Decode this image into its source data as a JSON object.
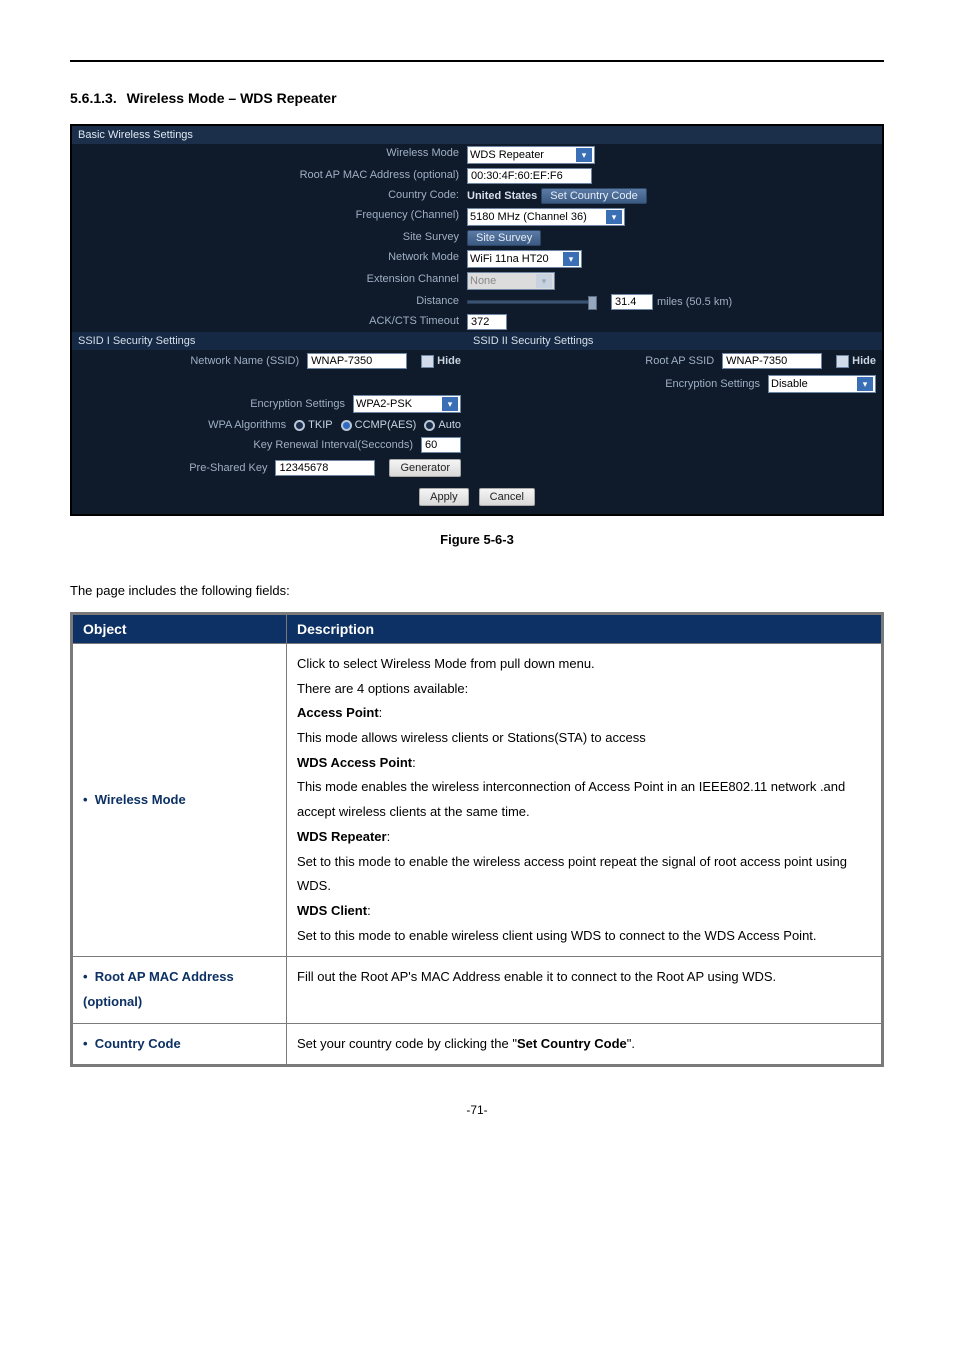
{
  "heading": {
    "num": "5.6.1.3.",
    "title": "Wireless Mode – WDS Repeater"
  },
  "panel": {
    "section_basic": "Basic Wireless Settings",
    "labels": {
      "wireless_mode": "Wireless Mode",
      "root_ap_mac": "Root AP MAC Address (optional)",
      "country_code": "Country Code:",
      "frequency": "Frequency (Channel)",
      "site_survey": "Site Survey",
      "network_mode": "Network Mode",
      "ext_channel": "Extension Channel",
      "distance": "Distance",
      "ack": "ACK/CTS Timeout"
    },
    "values": {
      "wireless_mode": "WDS Repeater",
      "root_ap_mac": "00:30:4F:60:EF:F6",
      "country_code_val": "United States",
      "set_country_code_btn": "Set Country Code",
      "frequency": "5180 MHz (Channel 36)",
      "site_survey_btn": "Site Survey",
      "network_mode": "WiFi 11na HT20",
      "ext_channel": "None",
      "distance_miles": "31.4",
      "distance_unit": "miles (50.5 km)",
      "ack": "372"
    },
    "sec_titles": {
      "ssid1": "SSID I Security Settings",
      "ssid2": "SSID II Security Settings"
    },
    "ssid1": {
      "network_name_lbl": "Network Name (SSID)",
      "network_name_val": "WNAP-7350",
      "hide_lbl": "Hide",
      "encryption_lbl": "Encryption Settings",
      "encryption_val": "WPA2-PSK",
      "wpa_alg_lbl": "WPA Algorithms",
      "tkip": "TKIP",
      "ccmp": "CCMP(AES)",
      "auto": "Auto",
      "key_renewal_lbl": "Key Renewal Interval(Secconds)",
      "key_renewal_val": "60",
      "psk_lbl": "Pre-Shared Key",
      "psk_val": "12345678",
      "gen_btn": "Generator"
    },
    "ssid2": {
      "root_ap_ssid_lbl": "Root AP SSID",
      "root_ap_ssid_val": "WNAP-7350",
      "hide_lbl": "Hide",
      "encryption_lbl": "Encryption Settings",
      "encryption_val": "Disable"
    },
    "actions": {
      "apply": "Apply",
      "cancel": "Cancel"
    }
  },
  "figure_caption": "Figure 5-6-3",
  "intro": "The page includes the following fields:",
  "table": {
    "headers": {
      "object": "Object",
      "description": "Description"
    },
    "rows": [
      {
        "object": "Wireless Mode",
        "desc": {
          "p1": "Click to select Wireless Mode from pull down menu.",
          "p2": "There are 4 options available:",
          "ap_t": "Access Point",
          "ap_d": "This mode allows wireless clients or Stations(STA) to access",
          "wdsap_t": "WDS Access Point",
          "wdsap_d": "This mode enables the wireless interconnection of Access Point in an IEEE802.11 network .and accept wireless clients at the same time.",
          "wdsrep_t": "WDS Repeater",
          "wdsrep_d": "Set to this mode to enable the wireless access point repeat the signal of root access point using WDS.",
          "wdscli_t": "WDS Client",
          "wdscli_d": "Set to this mode to enable wireless client using WDS to connect to the WDS Access Point."
        }
      },
      {
        "object": "Root AP MAC Address (optional)",
        "desc": {
          "p1": "Fill out the Root AP's MAC Address enable it to connect to the Root AP using WDS."
        }
      },
      {
        "object": "Country Code",
        "desc": {
          "p1a": "Set your country code by clicking the \"",
          "p1b": "Set Country Code",
          "p1c": "\"."
        }
      }
    ]
  },
  "pagenum": "-71-"
}
